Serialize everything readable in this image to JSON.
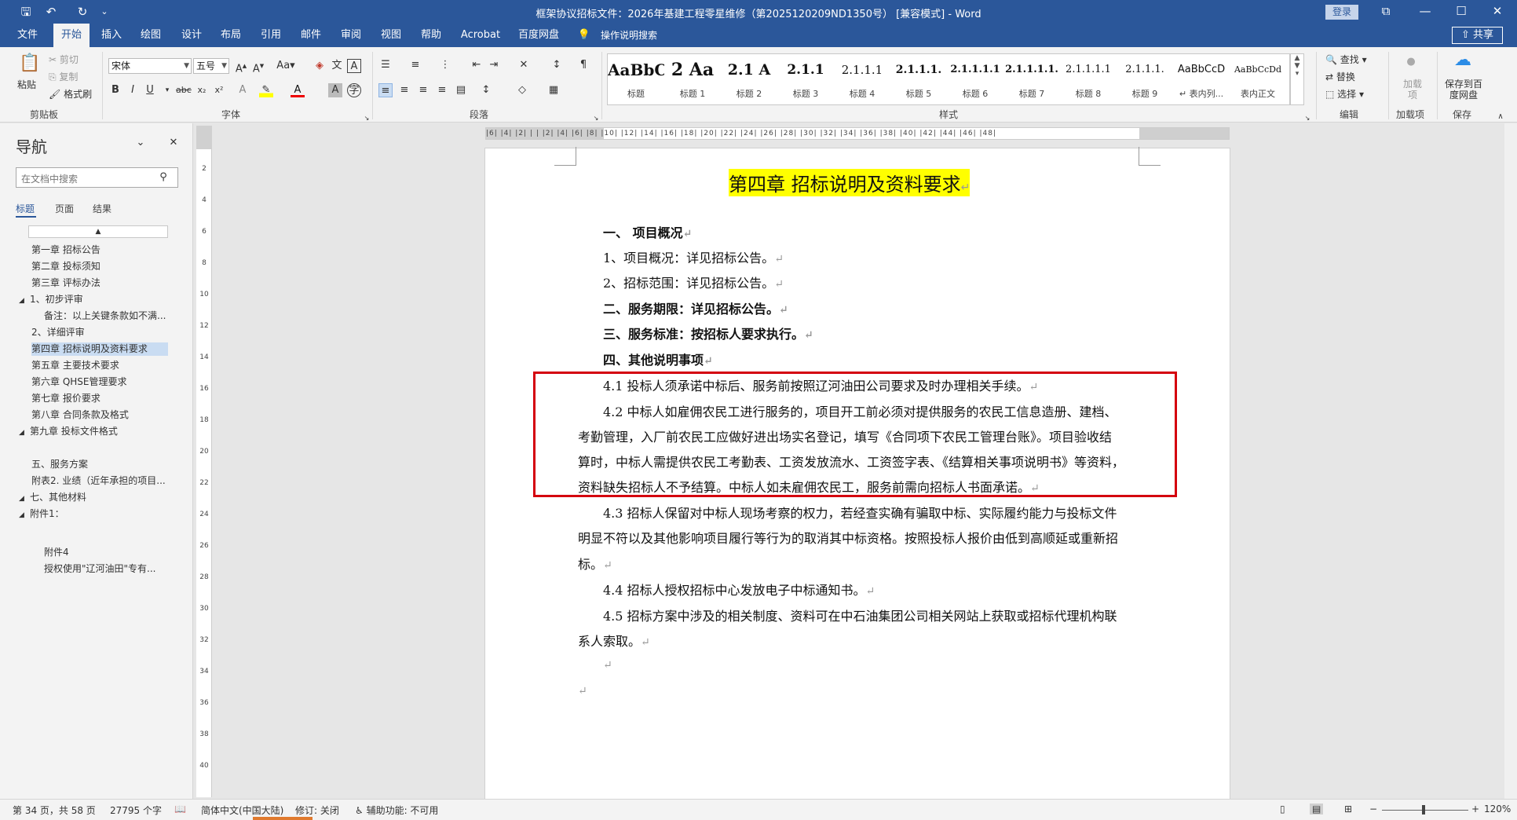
{
  "titlebar": {
    "title": "框架协议招标文件：2026年基建工程零星维修（第2025120209ND1350号） [兼容模式] - Word",
    "login": "登录",
    "qa_save": "🖫",
    "qa_undo": "↶",
    "qa_redo": "↻",
    "qa_customize": "⌄",
    "win_ribbon_opts": "⧉",
    "win_min": "—",
    "win_max": "☐",
    "win_close": "✕"
  },
  "tabs": [
    "文件",
    "开始",
    "插入",
    "绘图",
    "设计",
    "布局",
    "引用",
    "邮件",
    "审阅",
    "视图",
    "帮助",
    "Acrobat",
    "百度网盘"
  ],
  "tell_me": "操作说明搜索",
  "share": "共享",
  "ribbon": {
    "clipboard": {
      "paste": "粘贴",
      "cut": "剪切",
      "copy": "复制",
      "format_painter": "格式刷",
      "label": "剪贴板"
    },
    "font": {
      "name": "宋体",
      "size": "五号",
      "label": "字体"
    },
    "paragraph": {
      "label": "段落"
    },
    "styles": {
      "label": "样式",
      "items": [
        {
          "sample": "AaBbC",
          "name": "标题"
        },
        {
          "sample": "2 Aa",
          "name": "标题 1"
        },
        {
          "sample": "2.1 A",
          "name": "标题 2"
        },
        {
          "sample": "2.1.1",
          "name": "标题 3"
        },
        {
          "sample": "2.1.1.1",
          "name": "标题 4"
        },
        {
          "sample": "2.1.1.1.",
          "name": "标题 5"
        },
        {
          "sample": "2.1.1.1.1",
          "name": "标题 6"
        },
        {
          "sample": "2.1.1.1.1.",
          "name": "标题 7"
        },
        {
          "sample": "2.1.1.1.1",
          "name": "标题 8"
        },
        {
          "sample": "2.1.1.1.",
          "name": "标题 9"
        },
        {
          "sample": "AaBbCcD",
          "name": "↵ 表内列..."
        },
        {
          "sample": "AaBbCcDd",
          "name": "表内正文"
        }
      ]
    },
    "editing": {
      "find": "查找",
      "replace": "替换",
      "select": "选择",
      "label": "编辑"
    },
    "addins": {
      "btn": "加载项",
      "label": "加载项"
    },
    "save": {
      "btn": "保存到百度网盘",
      "label": "保存"
    }
  },
  "nav": {
    "title": "导航",
    "search_placeholder": "在文档中搜索",
    "tabs": [
      "标题",
      "页面",
      "结果"
    ],
    "items": [
      {
        "text": "第一章  招标公告",
        "level": 1,
        "tri": "",
        "sel": false
      },
      {
        "text": "第二章  投标须知",
        "level": 1,
        "tri": "",
        "sel": false
      },
      {
        "text": "第三章  评标办法",
        "level": 1,
        "tri": "",
        "sel": false
      },
      {
        "text": "1、初步评审",
        "level": 0,
        "tri": "◢",
        "sel": false
      },
      {
        "text": "备注：以上关键条款如不满...",
        "level": 2,
        "tri": "",
        "sel": false
      },
      {
        "text": "2、详细评审",
        "level": 1,
        "tri": "",
        "sel": false
      },
      {
        "text": "第四章  招标说明及资料要求",
        "level": 1,
        "tri": "",
        "sel": true
      },
      {
        "text": "第五章  主要技术要求",
        "level": 1,
        "tri": "",
        "sel": false
      },
      {
        "text": "第六章  QHSE管理要求",
        "level": 1,
        "tri": "",
        "sel": false
      },
      {
        "text": "第七章  报价要求",
        "level": 1,
        "tri": "",
        "sel": false
      },
      {
        "text": "第八章  合同条款及格式",
        "level": 1,
        "tri": "",
        "sel": false
      },
      {
        "text": "第九章  投标文件格式",
        "level": 0,
        "tri": "◢",
        "sel": false
      },
      {
        "text": "",
        "level": 1,
        "tri": "",
        "sel": false
      },
      {
        "text": "五、服务方案",
        "level": 1,
        "tri": "",
        "sel": false
      },
      {
        "text": "附表2. 业绩（近年承担的项目...",
        "level": 1,
        "tri": "",
        "sel": false
      },
      {
        "text": "七、其他材料",
        "level": 0,
        "tri": "◢",
        "sel": false
      },
      {
        "text": "附件1：",
        "level": 1,
        "tri": "◢",
        "sel": false
      },
      {
        "text": "",
        "level": 1,
        "tri": "",
        "sel": false
      },
      {
        "text": "附件4",
        "level": 2,
        "tri": "",
        "sel": false
      },
      {
        "text": "授权使用\"辽河油田\"专有...",
        "level": 2,
        "tri": "",
        "sel": false
      }
    ]
  },
  "document": {
    "title": "第四章    招标说明及资料要求",
    "paragraphs": [
      {
        "text": "一、  项目概况",
        "bold": true,
        "indent": "h"
      },
      {
        "text": "1、项目概况：详见招标公告。",
        "bold": false,
        "indent": "h"
      },
      {
        "text": "2、招标范围：详见招标公告。",
        "bold": false,
        "indent": "h"
      },
      {
        "text": "二、服务期限：详见招标公告。",
        "bold": true,
        "indent": "h"
      },
      {
        "text": "三、服务标准：按招标人要求执行。",
        "bold": true,
        "indent": "h"
      },
      {
        "text": "四、其他说明事项",
        "bold": true,
        "indent": "h"
      },
      {
        "text": "4.1 投标人须承诺中标后、服务前按照辽河油田公司要求及时办理相关手续。",
        "bold": false,
        "indent": "h"
      },
      {
        "text": "4.2 中标人如雇佣农民工进行服务的，项目开工前必须对提供服务的农民工信息造册、建档、",
        "bold": false,
        "indent": "h"
      },
      {
        "text": "考勤管理，入厂前农民工应做好进出场实名登记，填写《合同项下农民工管理台账》。项目验收结",
        "bold": false,
        "indent": "0"
      },
      {
        "text": "算时，中标人需提供农民工考勤表、工资发放流水、工资签字表、《结算相关事项说明书》等资料，",
        "bold": false,
        "indent": "0"
      },
      {
        "text": "资料缺失招标人不予结算。中标人如未雇佣农民工，服务前需向招标人书面承诺。",
        "bold": false,
        "indent": "0"
      },
      {
        "text": "4.3 招标人保留对中标人现场考察的权力，若经查实确有骗取中标、实际履约能力与投标文件",
        "bold": false,
        "indent": "h"
      },
      {
        "text": "明显不符以及其他影响项目履行等行为的取消其中标资格。按照投标人报价由低到高顺延或重新招",
        "bold": false,
        "indent": "0"
      },
      {
        "text": "标。",
        "bold": false,
        "indent": "0"
      },
      {
        "text": "4.4 招标人授权招标中心发放电子中标通知书。",
        "bold": false,
        "indent": "h"
      },
      {
        "text": "4.5 招标方案中涉及的相关制度、资料可在中石油集团公司相关网站上获取或招标代理机构联",
        "bold": false,
        "indent": "h"
      },
      {
        "text": "系人索取。",
        "bold": false,
        "indent": "0"
      },
      {
        "text": "",
        "bold": false,
        "indent": "h"
      },
      {
        "text": "",
        "bold": false,
        "indent": "0"
      }
    ],
    "para_mark": "↵"
  },
  "ruler": {
    "h_numbers": "|6| |4| |2| | | |2| |4| |6| |8| |10| |12| |14| |16| |18| |20| |22| |24| |26| |28| |30| |32| |34| |36| |38| |40| |42| |44| |46| |48|",
    "v_numbers": [
      "2",
      "4",
      "6",
      "8",
      "10",
      "12",
      "14",
      "16",
      "18",
      "20",
      "22",
      "24",
      "26",
      "28",
      "30",
      "32",
      "34",
      "36",
      "38",
      "40"
    ],
    "corner": "L"
  },
  "status": {
    "page": "第 34 页，共 58 页",
    "words": "27795 个字",
    "language": "简体中文(中国大陆)",
    "revisions": "修订: 关闭",
    "accessibility": "辅助功能: 不可用",
    "zoom": "120%",
    "zoom_minus": "−",
    "zoom_plus": "+"
  }
}
